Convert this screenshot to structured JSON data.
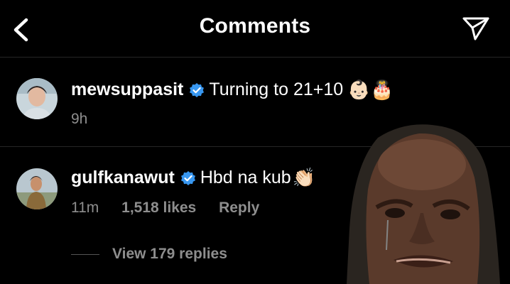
{
  "header": {
    "title": "Comments",
    "back_icon": "chevron-left-icon",
    "send_icon": "paper-plane-icon"
  },
  "comments": [
    {
      "username": "mewsuppasit",
      "verified": true,
      "text": "Turning to 21+10",
      "emojis": "👶🏻🎂",
      "time": "9h"
    },
    {
      "username": "gulfkanawut",
      "verified": true,
      "text": "Hbd na kub",
      "emojis": "👏🏻",
      "time": "11m",
      "likes": "1,518 likes",
      "reply_label": "Reply",
      "view_replies": "View 179 replies"
    }
  ],
  "colors": {
    "background": "#000000",
    "meta": "#8e8e8e",
    "verified": "#3897f0",
    "divider": "#262626"
  }
}
